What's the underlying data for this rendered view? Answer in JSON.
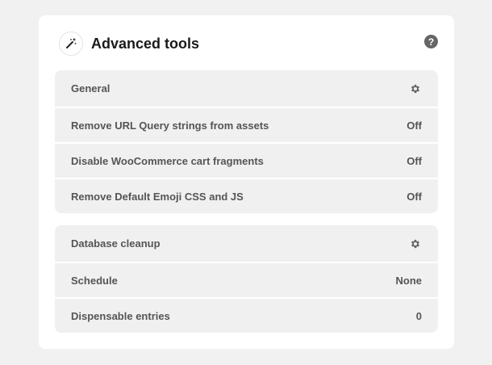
{
  "card": {
    "title": "Advanced tools",
    "help_label": "?"
  },
  "sections": [
    {
      "title": "General",
      "rows": [
        {
          "label": "Remove URL Query strings from assets",
          "value": "Off"
        },
        {
          "label": "Disable WooCommerce cart fragments",
          "value": "Off"
        },
        {
          "label": "Remove Default Emoji CSS and JS",
          "value": "Off"
        }
      ]
    },
    {
      "title": "Database cleanup",
      "rows": [
        {
          "label": "Schedule",
          "value": "None"
        },
        {
          "label": "Dispensable entries",
          "value": "0"
        }
      ]
    }
  ],
  "icons": {
    "header": "magic-wand-icon",
    "help": "question-mark-icon",
    "settings": "gear-icon"
  },
  "colors": {
    "background": "#f1f1f1",
    "card": "#ffffff",
    "row": "#f0f0f0",
    "title": "#1a1a1a",
    "text": "#555555",
    "icon": "#666666"
  }
}
